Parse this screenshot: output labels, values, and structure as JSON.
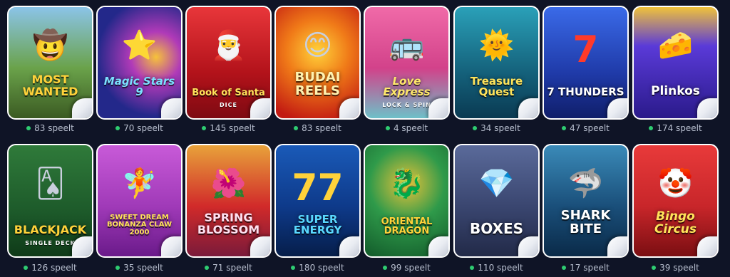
{
  "games_row1": [
    {
      "title": "MOST WANTED",
      "subtitle": "",
      "players": "83 speelt",
      "icon": "cowboy-icon",
      "color": "#5a8a3a"
    },
    {
      "title": "Magic Stars 9",
      "subtitle": "",
      "players": "70 speelt",
      "icon": "star-icon",
      "color": "#2a2f8f"
    },
    {
      "title": "Book of Santa",
      "subtitle": "DICE",
      "players": "145 speelt",
      "icon": "santa-icon",
      "color": "#c4151c"
    },
    {
      "title": "BUDAI REELS",
      "subtitle": "",
      "players": "83 speelt",
      "icon": "buddha-icon",
      "color": "#d83a12"
    },
    {
      "title": "Love Express",
      "subtitle": "LOCK & SPIN",
      "players": "4 speelt",
      "icon": "bus-icon",
      "color": "#d14a8a"
    },
    {
      "title": "Treasure Quest",
      "subtitle": "",
      "players": "34 speelt",
      "icon": "mask-icon",
      "color": "#1b6f8a"
    },
    {
      "title": "7 THUNDERS",
      "subtitle": "",
      "players": "47 speelt",
      "icon": "seven-icon",
      "color": "#1f3aa8"
    },
    {
      "title": "Plinkos",
      "subtitle": "",
      "players": "174 speelt",
      "icon": "plinko-icon",
      "color": "#3a2aa8"
    }
  ],
  "games_row2": [
    {
      "title": "BLACKJACK",
      "subtitle": "SINGLE DECK",
      "players": "126 speelt",
      "icon": "cards-icon",
      "color": "#1d5a2a"
    },
    {
      "title": "SWEET DREAM BONANZA CLAW 2000",
      "subtitle": "",
      "players": "35 speelt",
      "icon": "fairy-icon",
      "color": "#a03ab8"
    },
    {
      "title": "SPRING BLOSSOM",
      "subtitle": "",
      "players": "71 speelt",
      "icon": "flower-icon",
      "color": "#d12a2a"
    },
    {
      "title": "SUPER ENERGY",
      "subtitle": "",
      "players": "180 speelt",
      "icon": "seven-icon",
      "color": "#0e3a8a"
    },
    {
      "title": "ORIENTAL DRAGON",
      "subtitle": "",
      "players": "99 speelt",
      "icon": "dragon-icon",
      "color": "#1f7a3a"
    },
    {
      "title": "BOXES",
      "subtitle": "",
      "players": "110 speelt",
      "icon": "diamond-icon",
      "color": "#3a4670"
    },
    {
      "title": "SHARK BITE",
      "subtitle": "",
      "players": "17 speelt",
      "icon": "shark-icon",
      "color": "#1a4f7a"
    },
    {
      "title": "Bingo Circus",
      "subtitle": "",
      "players": "39 speelt",
      "icon": "clown-icon",
      "color": "#c8262a"
    }
  ]
}
